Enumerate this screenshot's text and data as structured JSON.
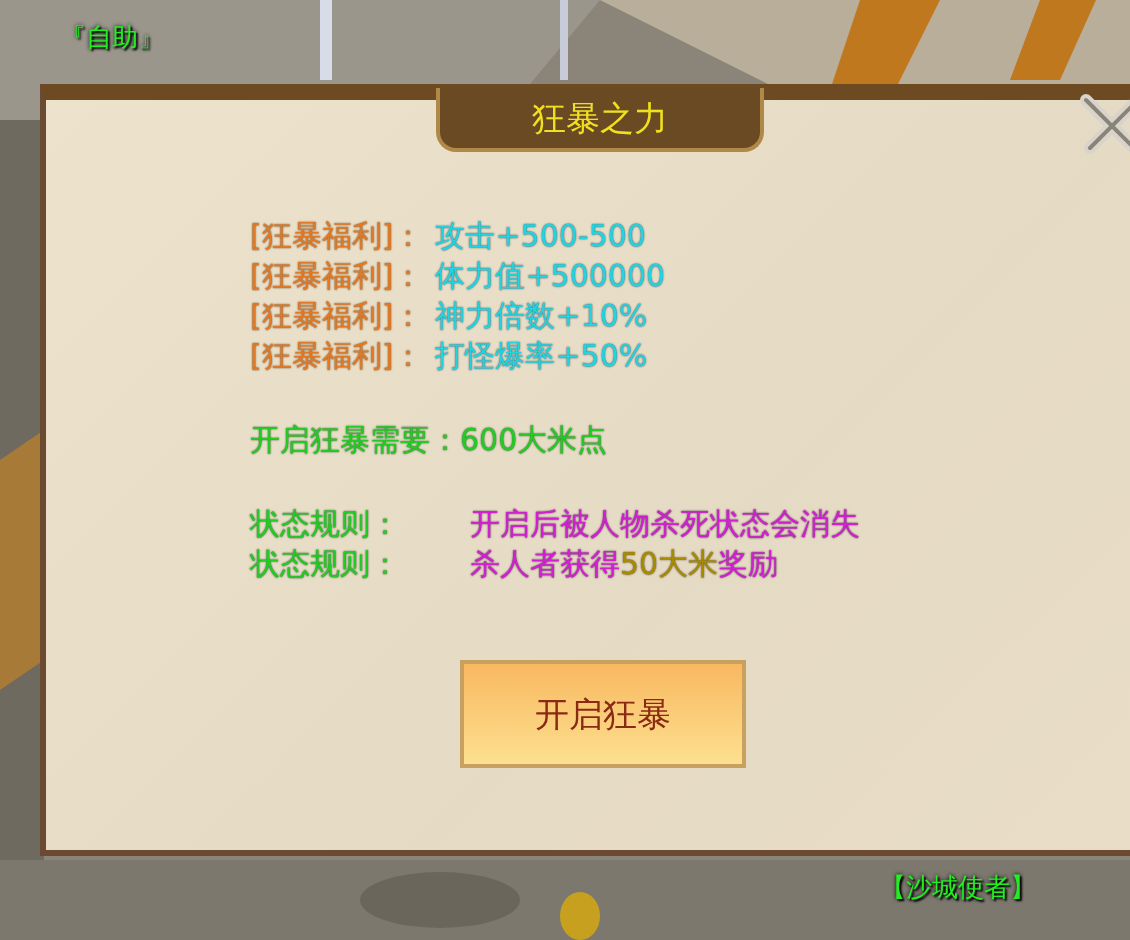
{
  "scene": {
    "npc_label_top": "『自助』",
    "npc_label_bottom": "【沙城使者】"
  },
  "dialog": {
    "title": "狂暴之力",
    "benefits": [
      {
        "label": "[狂暴福利]：",
        "value": "攻击+500-500"
      },
      {
        "label": "[狂暴福利]：",
        "value": "体力值+500000"
      },
      {
        "label": "[狂暴福利]：",
        "value": "神力倍数+10%"
      },
      {
        "label": "[狂暴福利]：",
        "value": "打怪爆率+50%"
      }
    ],
    "requirement": "开启狂暴需要：600大米点",
    "rules": [
      {
        "label": "状态规则：",
        "segments": [
          {
            "text": "开启后被人物杀死状态会消失",
            "kind": "normal"
          }
        ]
      },
      {
        "label": "状态规则：",
        "segments": [
          {
            "text": "杀人者获得",
            "kind": "normal"
          },
          {
            "text": "50大米",
            "kind": "highlight"
          },
          {
            "text": "奖励",
            "kind": "normal"
          }
        ]
      }
    ],
    "button": "开启狂暴"
  }
}
